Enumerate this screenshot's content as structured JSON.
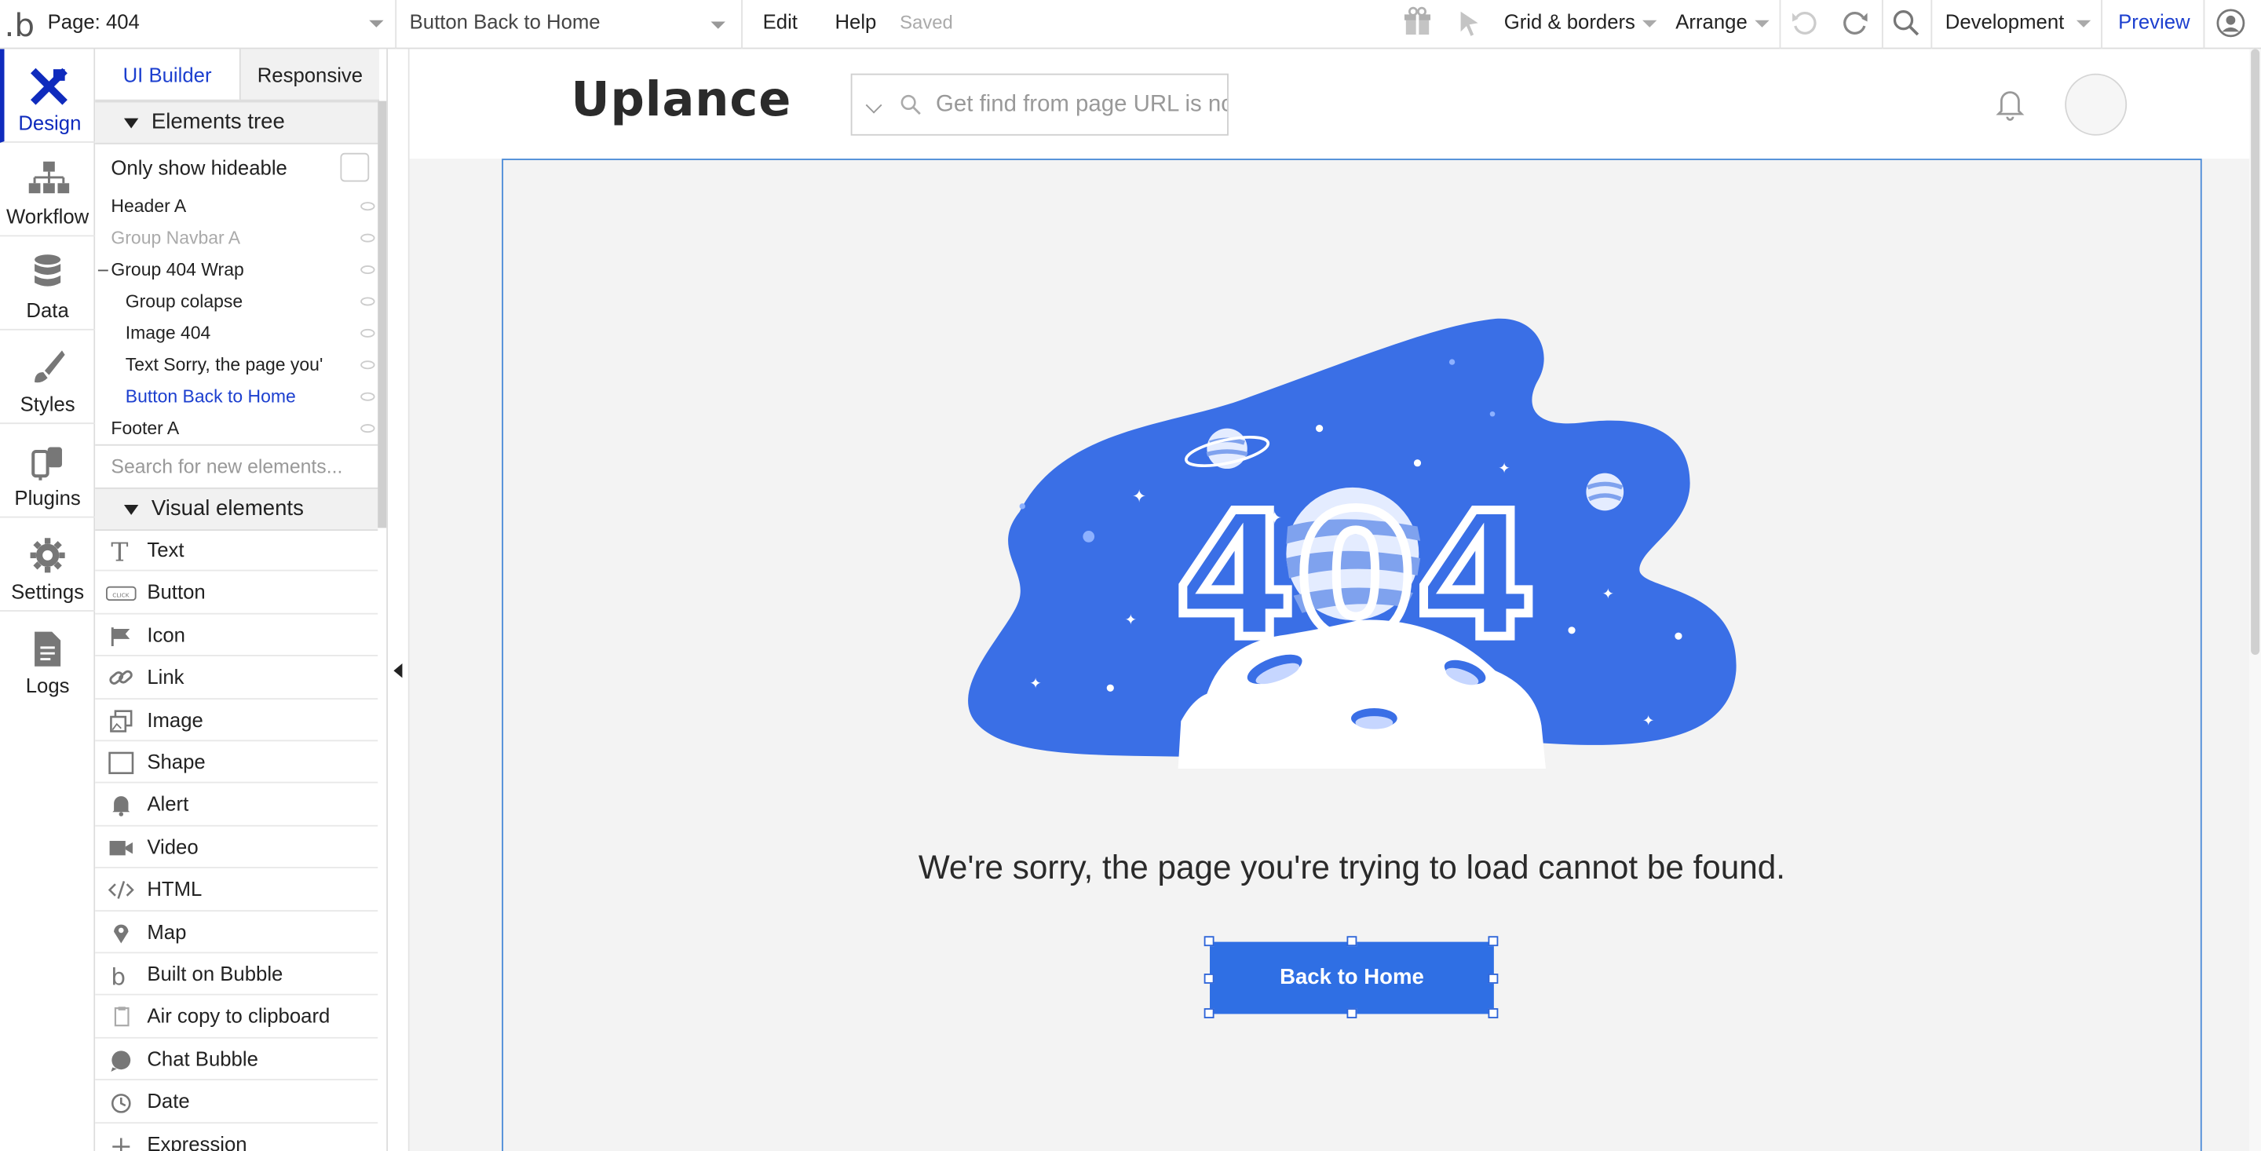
{
  "topbar": {
    "page_selector": "Page: 404",
    "element_selector": "Button Back to Home",
    "menu_edit": "Edit",
    "menu_help": "Help",
    "save_status": "Saved",
    "grid_borders": "Grid & borders",
    "arrange": "Arrange",
    "environment": "Development",
    "preview": "Preview"
  },
  "sidebar": {
    "tabs": [
      {
        "label": "Design",
        "icon": "design-icon",
        "active": true
      },
      {
        "label": "Workflow",
        "icon": "workflow-icon"
      },
      {
        "label": "Data",
        "icon": "database-icon"
      },
      {
        "label": "Styles",
        "icon": "brush-icon"
      },
      {
        "label": "Plugins",
        "icon": "plug-icon"
      },
      {
        "label": "Settings",
        "icon": "gear-icon"
      },
      {
        "label": "Logs",
        "icon": "document-icon"
      }
    ]
  },
  "panel": {
    "tab_ui_builder": "UI Builder",
    "tab_responsive": "Responsive",
    "elements_tree_title": "Elements tree",
    "only_show_hideable": "Only show hideable",
    "tree_items": [
      {
        "label": "Header A"
      },
      {
        "label": "Group Navbar A"
      },
      {
        "label": "Group 404 Wrap"
      },
      {
        "label": "Group colapse"
      },
      {
        "label": "Image 404"
      },
      {
        "label": "Text Sorry, the page you'"
      },
      {
        "label": "Button Back to Home"
      },
      {
        "label": "Footer A"
      }
    ],
    "search_placeholder": "Search for new elements...",
    "visual_elements_title": "Visual elements",
    "visual_elements": [
      {
        "label": "Text",
        "icon": "text-icon"
      },
      {
        "label": "Button",
        "icon": "button-icon"
      },
      {
        "label": "Icon",
        "icon": "flag-icon"
      },
      {
        "label": "Link",
        "icon": "link-icon"
      },
      {
        "label": "Image",
        "icon": "image-icon"
      },
      {
        "label": "Shape",
        "icon": "shape-icon"
      },
      {
        "label": "Alert",
        "icon": "bell-icon"
      },
      {
        "label": "Video",
        "icon": "video-icon"
      },
      {
        "label": "HTML",
        "icon": "code-icon"
      },
      {
        "label": "Map",
        "icon": "pin-icon"
      },
      {
        "label": "Built on Bubble",
        "icon": "bubble-logo-icon"
      },
      {
        "label": "Air copy to clipboard",
        "icon": "clipboard-icon"
      },
      {
        "label": "Chat Bubble",
        "icon": "chat-icon"
      },
      {
        "label": "Date",
        "icon": "clock-icon"
      },
      {
        "label": "Expression",
        "icon": "plus-icon"
      }
    ]
  },
  "page": {
    "logo": "Uplance",
    "search_placeholder": "Get find from page URL is not",
    "error_404_image_text": "404",
    "message": "We're sorry, the page you're trying to load cannot be found.",
    "back_button": "Back to Home"
  },
  "colors": {
    "accent": "#0f2bbd",
    "illustration_blue": "#3a6fe6",
    "button_blue": "#2f6fe4"
  }
}
